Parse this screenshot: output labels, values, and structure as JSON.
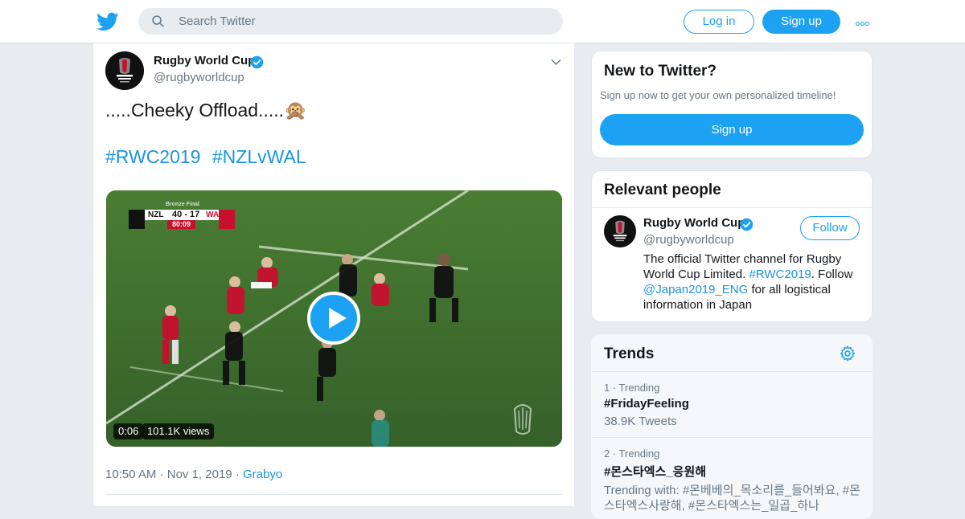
{
  "header": {
    "logo_icon": "twitter-bird-icon",
    "search_placeholder": "Search Twitter",
    "login_label": "Log in",
    "signup_label": "Sign up",
    "more_icon": "more-dots-icon",
    "accent_color": "#1da1f2"
  },
  "tweet": {
    "author_name": "Rugby World Cup",
    "author_handle": "@rugbyworldcup",
    "text": ".....Cheeky Offload.....🙊",
    "hashtags": [
      "#RWC2019",
      "#NZLvWAL"
    ],
    "video": {
      "duration": "0:06",
      "views": "101.1K views",
      "scoreboard": {
        "label": "Bronze Final",
        "team_home": "NZL",
        "score": "40 - 17",
        "team_away": "WAL",
        "clock": "80:09"
      }
    },
    "time": "10:50 AM",
    "date": "Nov 1, 2019",
    "source": "Grabyo"
  },
  "signup_card": {
    "title": "New to Twitter?",
    "subtitle": "Sign up now to get your own personalized timeline!",
    "button_label": "Sign up"
  },
  "relevant_people": {
    "title": "Relevant people",
    "name": "Rugby World Cup",
    "handle": "@rugbyworldcup",
    "follow_label": "Follow",
    "bio_part1": "The official Twitter channel for Rugby World Cup Limited. ",
    "bio_link1": "#RWC2019",
    "bio_part2": ". Follow ",
    "bio_link2": "@Japan2019_ENG",
    "bio_part3": " for all logistical information in Japan"
  },
  "trends": {
    "title": "Trends",
    "items": [
      {
        "meta": "1 · Trending",
        "name": "#FridayFeeling",
        "detail": "38.9K Tweets"
      },
      {
        "meta": "2 · Trending",
        "name": "#몬스타엑스_응원해",
        "detail": "Trending with: #몬베베의_목소리를_들어봐요, #몬스타엑스사랑해, #몬스타엑스는_일곱_하나"
      }
    ]
  }
}
